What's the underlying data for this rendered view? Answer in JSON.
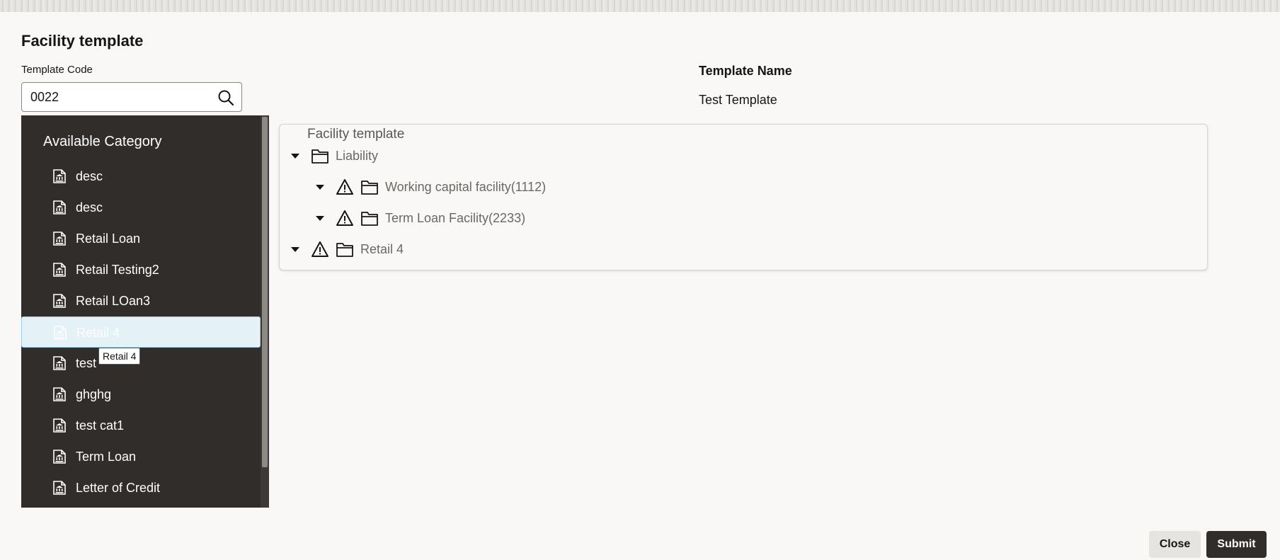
{
  "page": {
    "title": "Facility template"
  },
  "template_code": {
    "label": "Template Code",
    "value": "0022"
  },
  "template_name": {
    "label": "Template Name",
    "value": "Test Template"
  },
  "category_panel": {
    "title": "Available Category",
    "items": [
      {
        "label": "desc"
      },
      {
        "label": "desc"
      },
      {
        "label": "Retail Loan"
      },
      {
        "label": "Retail Testing2"
      },
      {
        "label": "Retail LOan3"
      },
      {
        "label": "Retail 4",
        "selected": true
      },
      {
        "label": "test"
      },
      {
        "label": "ghghg"
      },
      {
        "label": "test cat1"
      },
      {
        "label": "Term Loan"
      },
      {
        "label": "Letter of Credit"
      }
    ],
    "tooltip": "Retail 4"
  },
  "tree": {
    "title": "Facility template",
    "nodes": [
      {
        "label": "Liability",
        "level": 0,
        "warning": false,
        "expanded": true
      },
      {
        "label": "Working capital facility(1112)",
        "level": 1,
        "warning": true,
        "expanded": true
      },
      {
        "label": "Term Loan Facility(2233)",
        "level": 1,
        "warning": true,
        "expanded": true
      },
      {
        "label": "Retail 4",
        "level": 0,
        "warning": true,
        "expanded": true
      }
    ]
  },
  "icons": {
    "category_item": "bank-document-icon",
    "search": "search-icon",
    "expand": "caret-down-icon",
    "warning": "warning-triangle-icon",
    "folder": "folder-icon"
  },
  "footer": {
    "close_label": "Close",
    "submit_label": "Submit"
  },
  "colors": {
    "panel_bg": "#312d2a",
    "selected_bg": "#e4f1f7",
    "submit_bg": "#312d2a"
  }
}
